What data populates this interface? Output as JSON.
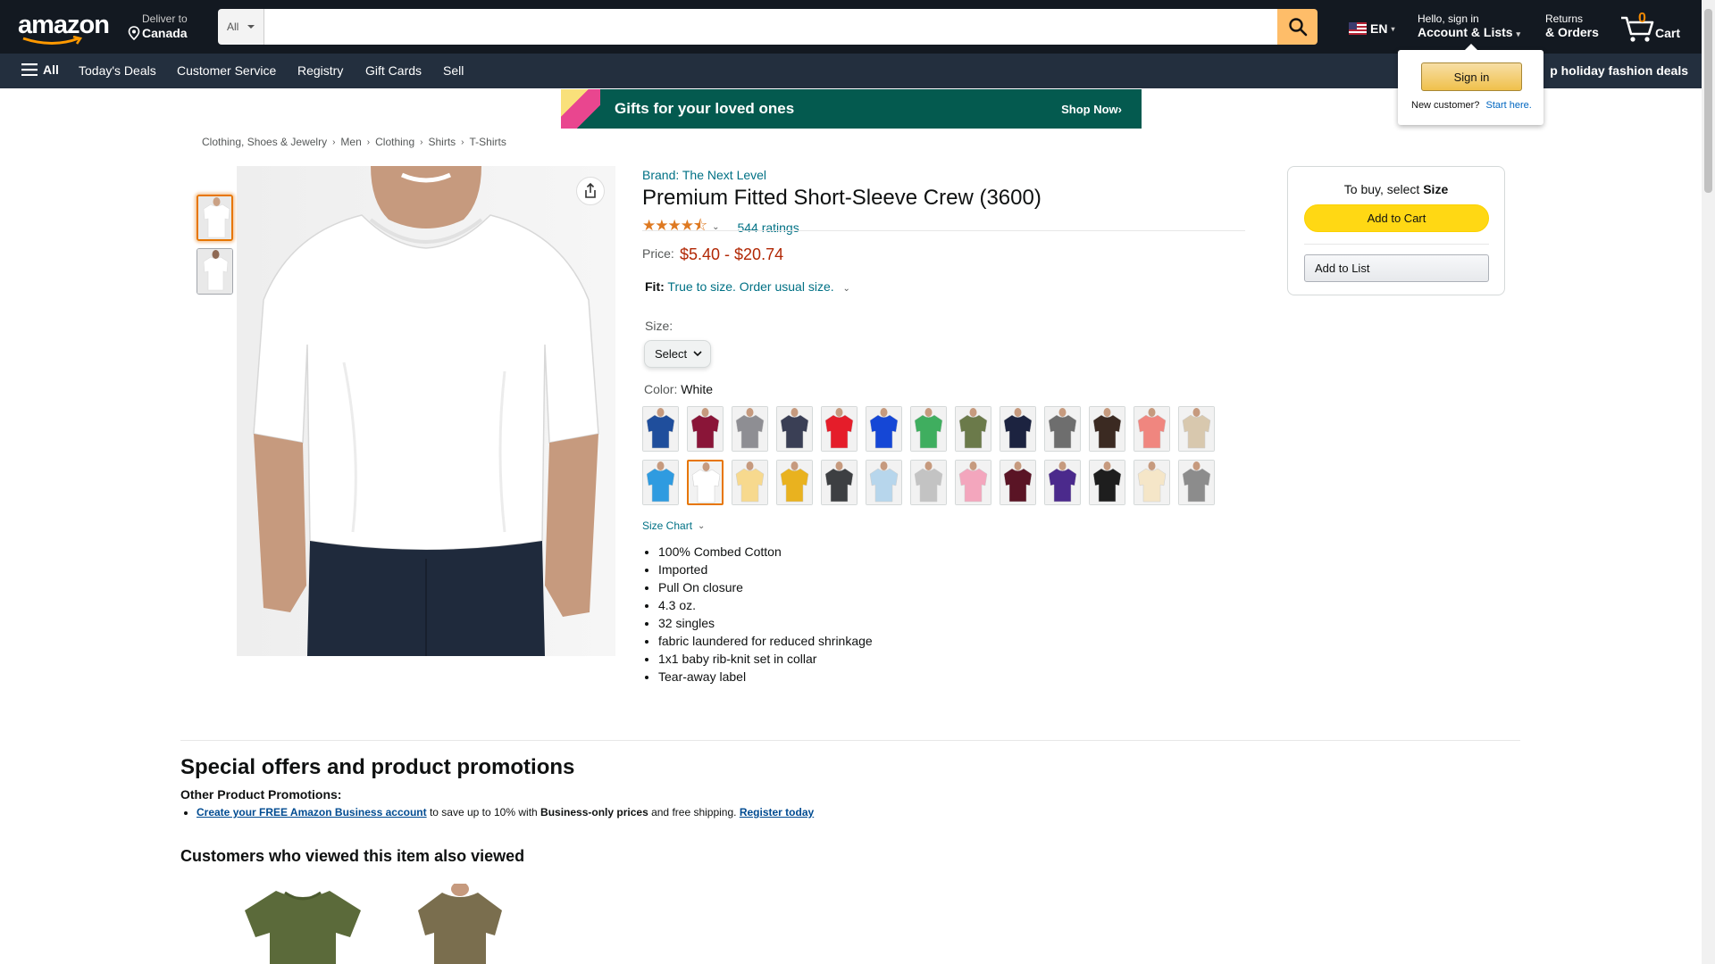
{
  "header": {
    "logo_text": "amazon",
    "deliver_line1": "Deliver to",
    "deliver_line2": "Canada",
    "search_category": "All",
    "search_placeholder": "",
    "language": "EN",
    "account_line1": "Hello, sign in",
    "account_line2": "Account & Lists",
    "returns_line1": "Returns",
    "returns_line2": "& Orders",
    "cart_count": "0",
    "cart_label": "Cart"
  },
  "nav": {
    "all_label": "All",
    "links": [
      "Today's Deals",
      "Customer Service",
      "Registry",
      "Gift Cards",
      "Sell"
    ],
    "promo_right": "p holiday fashion deals"
  },
  "flyout": {
    "signin_label": "Sign in",
    "new_customer": "New customer?",
    "start_here": "Start here."
  },
  "banner": {
    "text": "Gifts for your loved ones",
    "cta": "Shop Now›"
  },
  "breadcrumb": [
    "Clothing, Shoes & Jewelry",
    "Men",
    "Clothing",
    "Shirts",
    "T-Shirts"
  ],
  "product": {
    "brand": "Brand: The Next Level",
    "title": "Premium Fitted Short-Sleeve Crew (3600)",
    "rating_value": 4.5,
    "ratings_count": "544 ratings",
    "price_label": "Price:",
    "price_range": "$5.40 - $20.74",
    "fit_label": "Fit:",
    "fit_text": "True to size. Order usual size.",
    "size_label": "Size:",
    "size_select": "Select",
    "color_label": "Color:",
    "color_value": "White",
    "size_chart": "Size Chart",
    "bullets": [
      "100% Combed Cotton",
      "Imported",
      "Pull On closure",
      "4.3 oz.",
      "32 singles",
      "fabric laundered for reduced shrinkage",
      "1x1 baby rib-knit set in collar",
      "Tear-away label"
    ],
    "swatch_colors": [
      "#1f4e9c",
      "#8a1538",
      "#8e8e93",
      "#3a3f55",
      "#e51d2a",
      "#1547d6",
      "#3fae5f",
      "#6b7a4a",
      "#1c2340",
      "#6e6e6e",
      "#3b2a22",
      "#f0867f",
      "#d8c8ae",
      "#2f9be0",
      "#ffffff",
      "#f7d98e",
      "#e9b21f",
      "#3d3f42",
      "#b7d6ec",
      "#c3c3c3",
      "#f3a6bd",
      "#5a1425",
      "#4b2a8c",
      "#1e1e1e",
      "#f5e6c8",
      "#8c8c8c"
    ],
    "selected_swatch_index": 14
  },
  "buybox": {
    "to_buy_prefix": "To buy, select ",
    "to_buy_bold": "Size",
    "add_to_cart": "Add to Cart",
    "add_to_list": "Add to List"
  },
  "promotions": {
    "heading": "Special offers and product promotions",
    "subheading": "Other Product Promotions:",
    "item_link": "Create your FREE Amazon Business account",
    "item_mid": " to save up to 10% with ",
    "item_bold": "Business-only prices",
    "item_end": " and free shipping. ",
    "item_link2": "Register today"
  },
  "also_viewed": {
    "heading": "Customers who viewed this item also viewed",
    "colors": [
      "#5b6a3a",
      "#7a6e4e"
    ]
  }
}
